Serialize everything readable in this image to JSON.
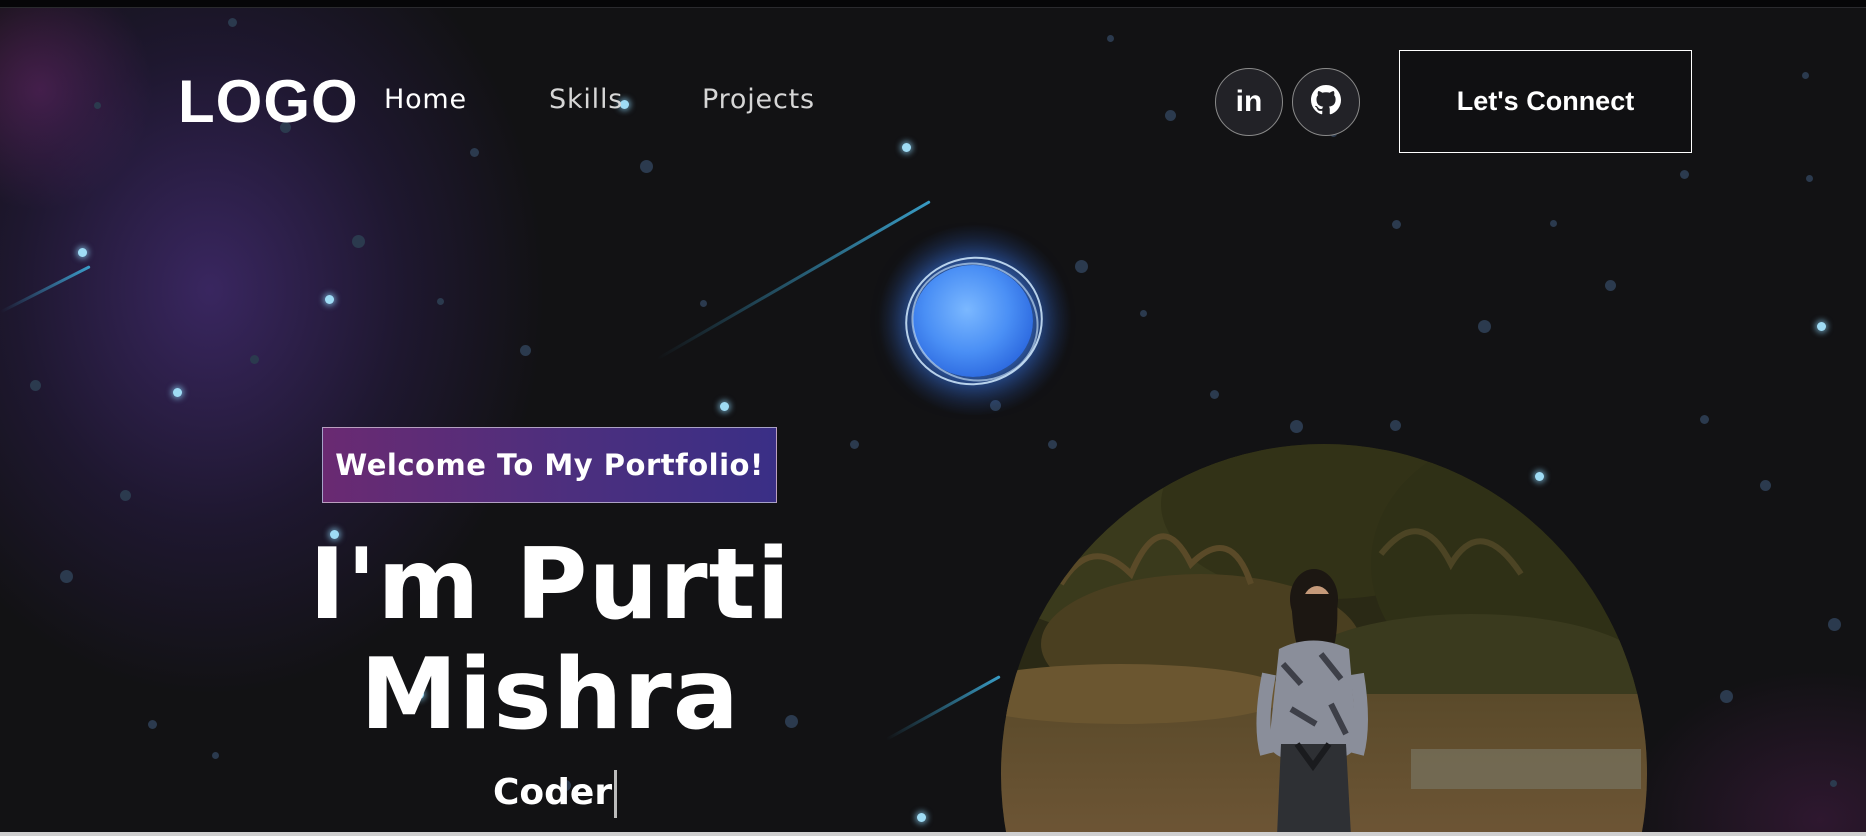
{
  "navbar": {
    "logo": "LOGO",
    "links": [
      {
        "label": "Home",
        "active": true
      },
      {
        "label": "Skills",
        "active": false
      },
      {
        "label": "Projects",
        "active": false
      }
    ],
    "social": [
      {
        "label": "in",
        "icon": "linkedin-icon"
      },
      {
        "label": "",
        "icon": "github-icon"
      }
    ],
    "cta_label": "Let's Connect"
  },
  "hero": {
    "tagline": "Welcome To My Portfolio!",
    "name_line1": "I'm Purti",
    "name_line2": "Mishra",
    "role": "Coder"
  },
  "colors": {
    "background": "#121214",
    "tagline_gradient_start": "#6a2a72",
    "tagline_gradient_end": "#3a2f86",
    "orb": "#4a8ff5",
    "star_bright": "#9fdcf5"
  }
}
